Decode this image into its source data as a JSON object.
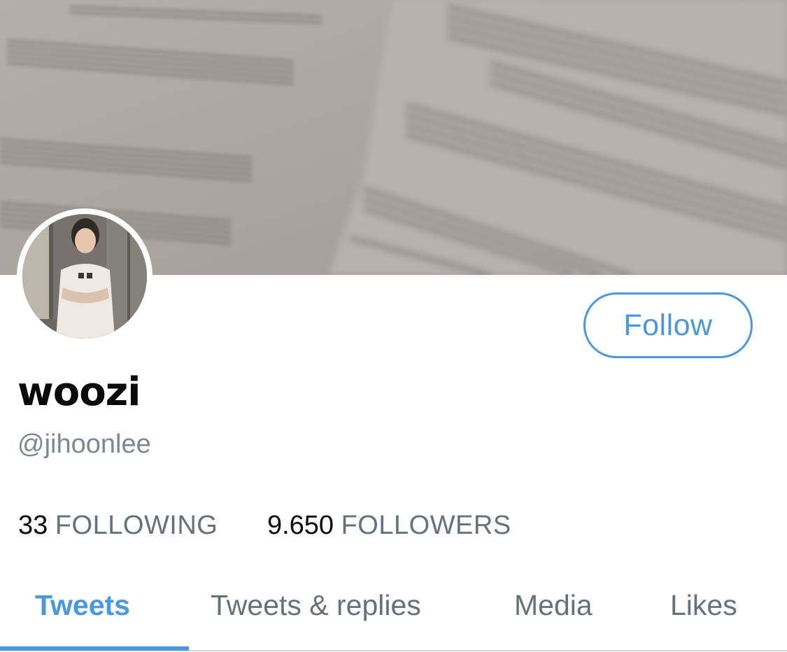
{
  "profile": {
    "display_name": "woozi",
    "handle": "@jihoonlee",
    "follow_label": "Follow"
  },
  "stats": {
    "following_count": "33",
    "following_label": "FOLLOWING",
    "followers_count": "9.650",
    "followers_label": "FOLLOWERS"
  },
  "tabs": [
    {
      "label": "Tweets",
      "active": true
    },
    {
      "label": "Tweets & replies",
      "active": false
    },
    {
      "label": "Media",
      "active": false
    },
    {
      "label": "Likes",
      "active": false
    }
  ],
  "colors": {
    "accent": "#4a98e0",
    "muted_text": "#67707b",
    "primary_text": "#0a0a0a"
  }
}
